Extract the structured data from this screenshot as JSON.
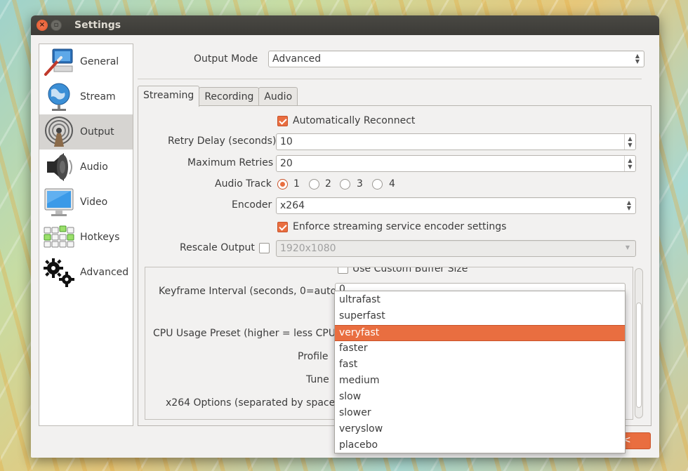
{
  "window": {
    "title": "Settings"
  },
  "sidebar": {
    "items": [
      {
        "label": "General",
        "icon": "monitor-wand-icon"
      },
      {
        "label": "Stream",
        "icon": "globe-icon"
      },
      {
        "label": "Output",
        "icon": "broadcast-icon",
        "selected": true
      },
      {
        "label": "Audio",
        "icon": "speaker-icon"
      },
      {
        "label": "Video",
        "icon": "monitor-icon"
      },
      {
        "label": "Hotkeys",
        "icon": "keyboard-icon"
      },
      {
        "label": "Advanced",
        "icon": "gears-icon"
      }
    ]
  },
  "output_mode": {
    "label": "Output Mode",
    "value": "Advanced"
  },
  "tabs": [
    {
      "label": "Streaming",
      "active": true
    },
    {
      "label": "Recording"
    },
    {
      "label": "Audio"
    }
  ],
  "streaming": {
    "auto_reconnect": {
      "label": "Automatically Reconnect",
      "checked": true
    },
    "retry_delay": {
      "label": "Retry Delay (seconds)",
      "value": "10"
    },
    "max_retries": {
      "label": "Maximum Retries",
      "value": "20"
    },
    "audio_track": {
      "label": "Audio Track",
      "options": [
        "1",
        "2",
        "3",
        "4"
      ],
      "selected": "1"
    },
    "encoder": {
      "label": "Encoder",
      "value": "x264"
    },
    "enforce": {
      "label": "Enforce streaming service encoder settings",
      "checked": true
    },
    "rescale": {
      "label": "Rescale Output",
      "checked": false,
      "value": "1920x1080"
    },
    "custom_buffer": {
      "label": "Use Custom Buffer Size"
    },
    "keyframe": {
      "label": "Keyframe Interval (seconds, 0=auto)",
      "value": "0"
    },
    "cpu_preset": {
      "label": "CPU Usage Preset (higher = less CPU)"
    },
    "profile": {
      "label": "Profile"
    },
    "tune": {
      "label": "Tune"
    },
    "x264_options": {
      "label": "x264 Options (separated by space)"
    }
  },
  "preset_dropdown": {
    "options": [
      "ultrafast",
      "superfast",
      "veryfast",
      "faster",
      "fast",
      "medium",
      "slow",
      "slower",
      "veryslow",
      "placebo"
    ],
    "selected": "veryfast"
  },
  "colors": {
    "accent": "#e96e40",
    "titlebar": "#3c3b37"
  }
}
